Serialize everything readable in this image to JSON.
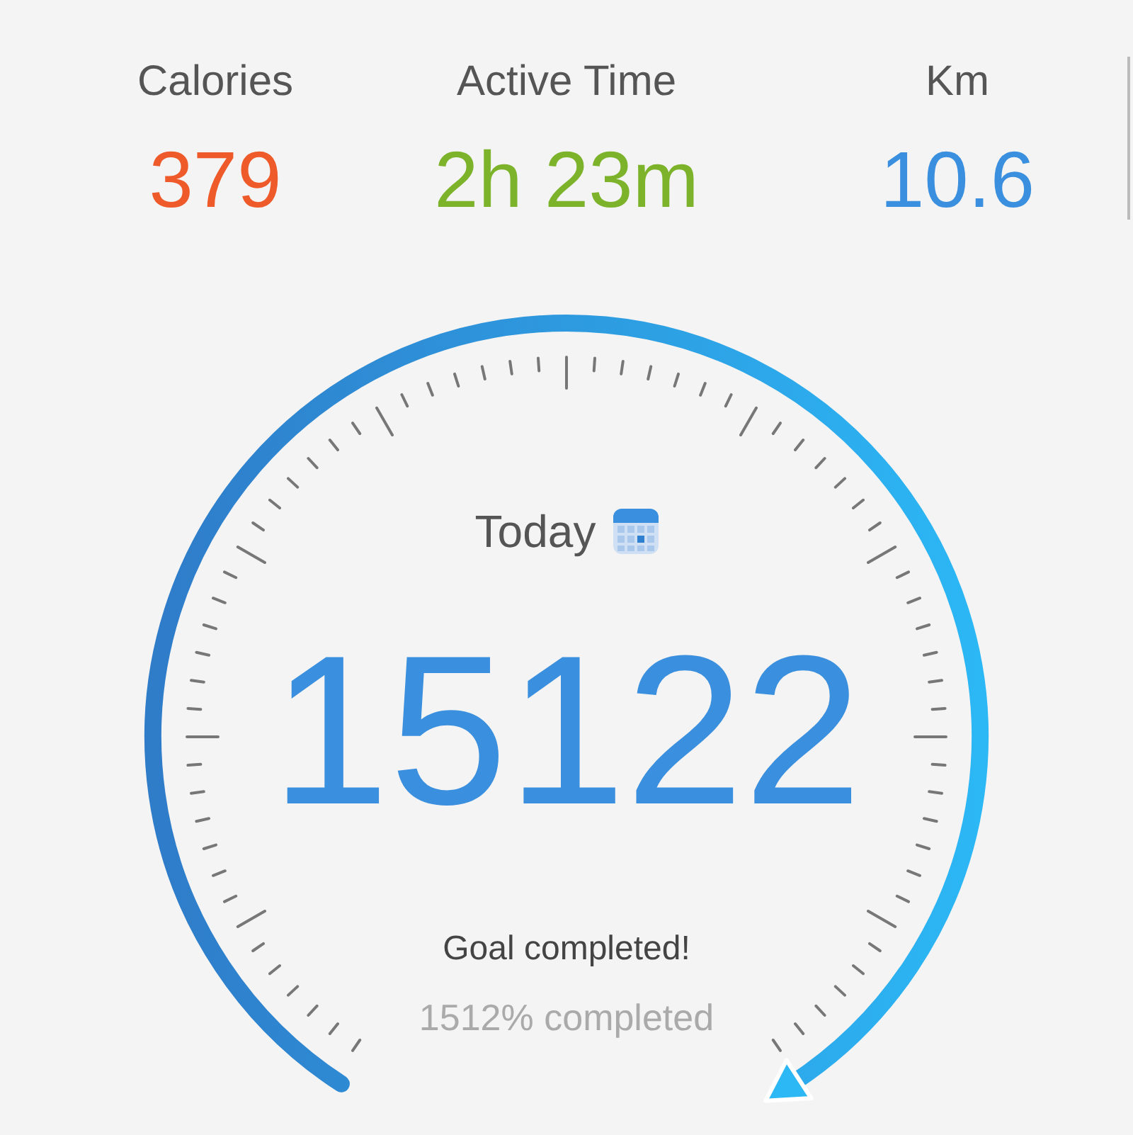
{
  "stats": [
    {
      "label": "Calories",
      "value": "379",
      "color": "#ee5a2a"
    },
    {
      "label": "Active Time",
      "value": "2h 23m",
      "color": "#7cb32b"
    },
    {
      "label": "Km",
      "value": "10.6",
      "color": "#3a8fde"
    }
  ],
  "gauge": {
    "period": "Today",
    "steps": "15122",
    "status": "Goal completed!",
    "percent": "1512% completed"
  }
}
